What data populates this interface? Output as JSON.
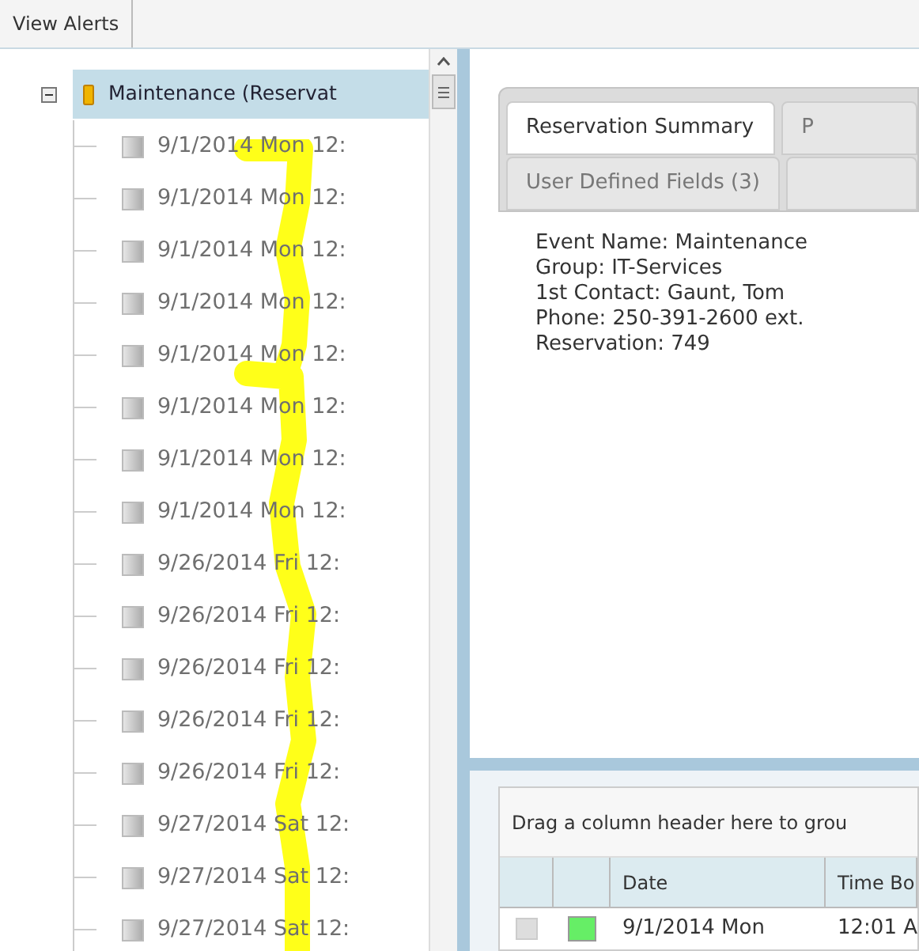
{
  "top_tabs": [
    {
      "label": "View Alerts",
      "selected": true
    }
  ],
  "tree": {
    "label": "Maintenance (Reservat",
    "expanded": true,
    "selected": true,
    "children": [
      {
        "label": "9/1/2014 Mon 12:"
      },
      {
        "label": "9/1/2014 Mon 12:"
      },
      {
        "label": "9/1/2014 Mon 12:"
      },
      {
        "label": "9/1/2014 Mon 12:"
      },
      {
        "label": "9/1/2014 Mon 12:"
      },
      {
        "label": "9/1/2014 Mon 12:"
      },
      {
        "label": "9/1/2014 Mon 12:"
      },
      {
        "label": "9/1/2014 Mon 12:"
      },
      {
        "label": "9/26/2014 Fri 12:"
      },
      {
        "label": "9/26/2014 Fri 12:"
      },
      {
        "label": "9/26/2014 Fri 12:"
      },
      {
        "label": "9/26/2014 Fri 12:"
      },
      {
        "label": "9/26/2014 Fri 12:"
      },
      {
        "label": "9/27/2014 Sat 12:"
      },
      {
        "label": "9/27/2014 Sat 12:"
      },
      {
        "label": "9/27/2014 Sat 12:"
      }
    ]
  },
  "detail_tabs": [
    [
      {
        "label": "Reservation Summary",
        "selected": true
      },
      {
        "label": "P",
        "selected": false
      }
    ],
    [
      {
        "label": "User Defined Fields (3)",
        "selected": false
      },
      {
        "selected": false
      }
    ]
  ],
  "summary": [
    "Event Name: Maintenance",
    "Group: IT-Services",
    "1st Contact: Gaunt, Tom",
    "Phone: 250-391-2600 ext.",
    "Reservation: 749"
  ],
  "grid": {
    "group_hint": "Drag a column header here to grou",
    "columns": [
      null,
      null,
      "Date",
      "Time Bo"
    ],
    "rows": [
      {
        "checked": false,
        "color": "#66ee66",
        "date": "9/1/2014 Mon",
        "time": "12:01 A"
      }
    ]
  }
}
